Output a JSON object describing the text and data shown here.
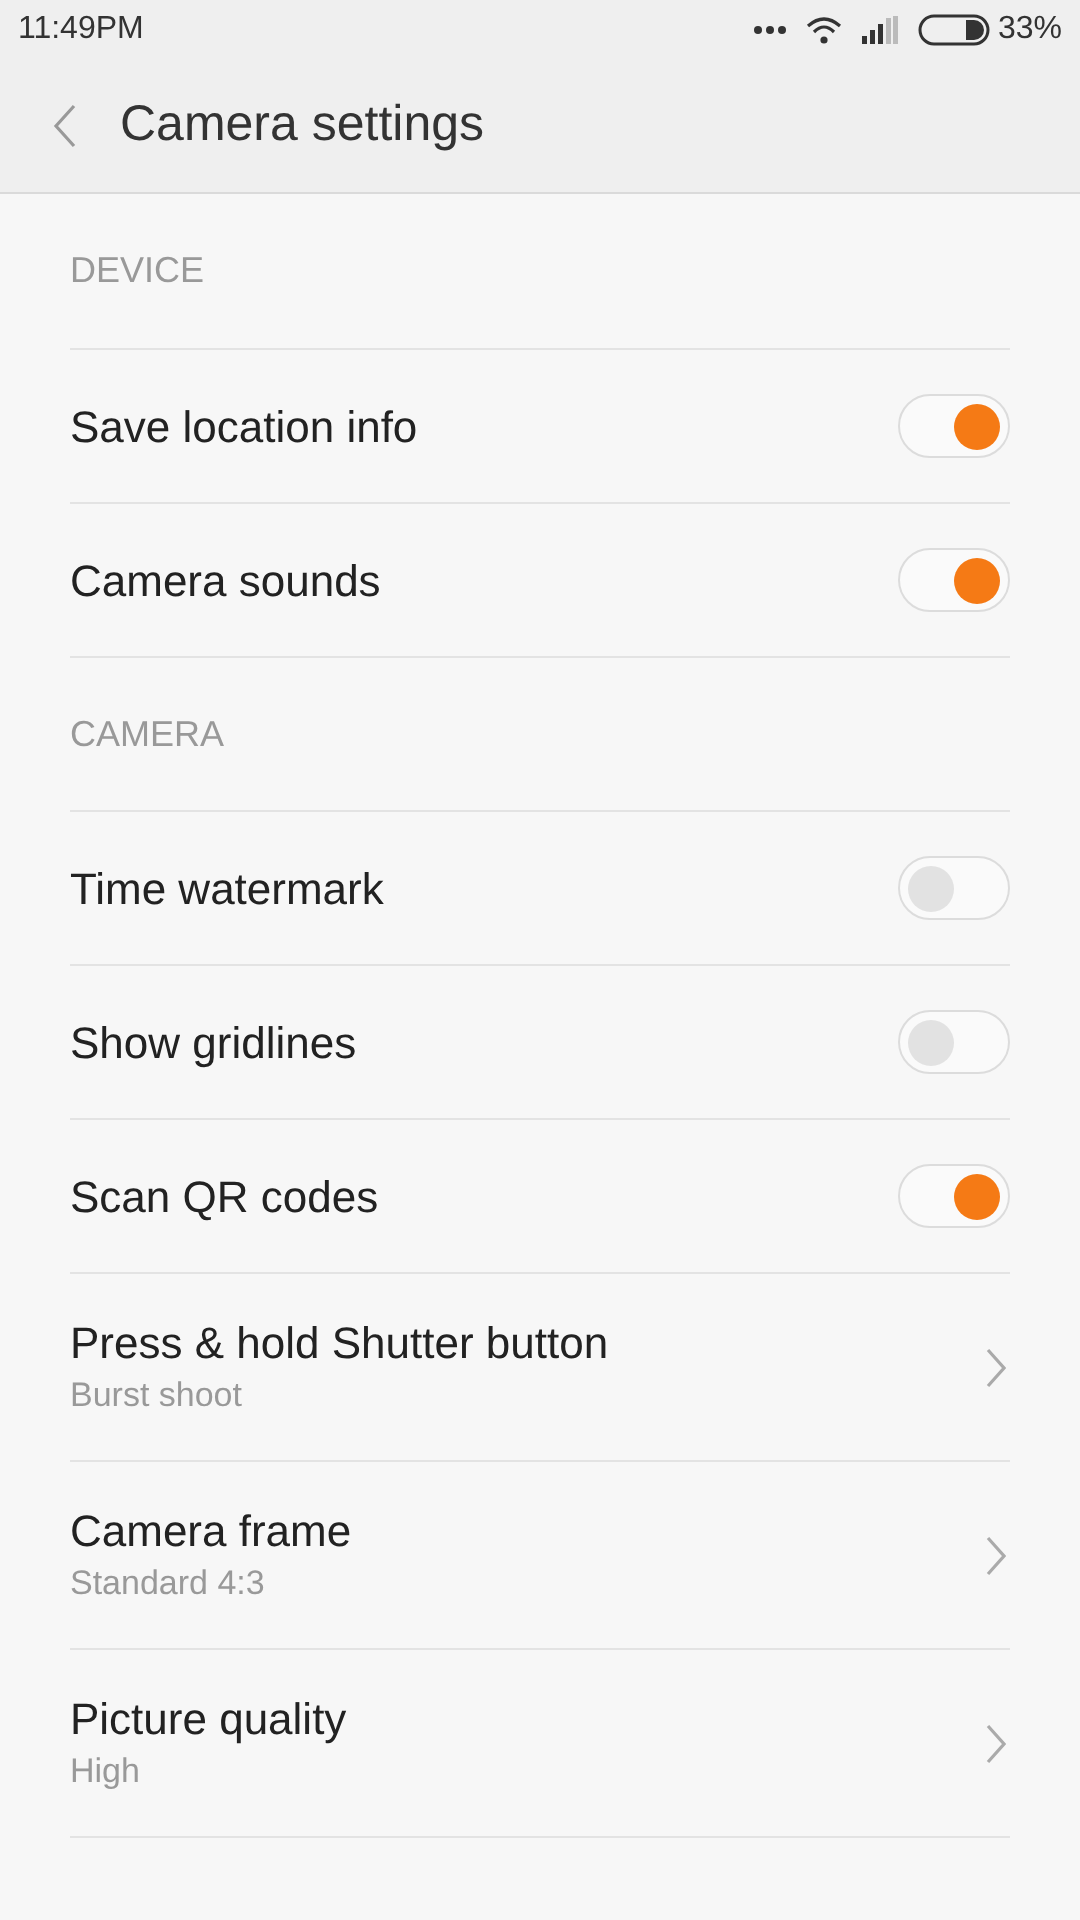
{
  "status_bar": {
    "time": "11:49PM",
    "battery": "33%"
  },
  "header": {
    "title": "Camera settings"
  },
  "sections": [
    {
      "title": "DEVICE",
      "items": [
        {
          "kind": "toggle",
          "label": "Save location info",
          "on": true
        },
        {
          "kind": "toggle",
          "label": "Camera sounds",
          "on": true
        }
      ]
    },
    {
      "title": "CAMERA",
      "items": [
        {
          "kind": "toggle",
          "label": "Time watermark",
          "on": false
        },
        {
          "kind": "toggle",
          "label": "Show gridlines",
          "on": false
        },
        {
          "kind": "toggle",
          "label": "Scan QR codes",
          "on": true
        },
        {
          "kind": "nav",
          "label": "Press & hold Shutter button",
          "value": "Burst shoot"
        },
        {
          "kind": "nav",
          "label": "Camera frame",
          "value": "Standard 4:3"
        },
        {
          "kind": "nav",
          "label": "Picture quality",
          "value": "High"
        }
      ]
    }
  ]
}
